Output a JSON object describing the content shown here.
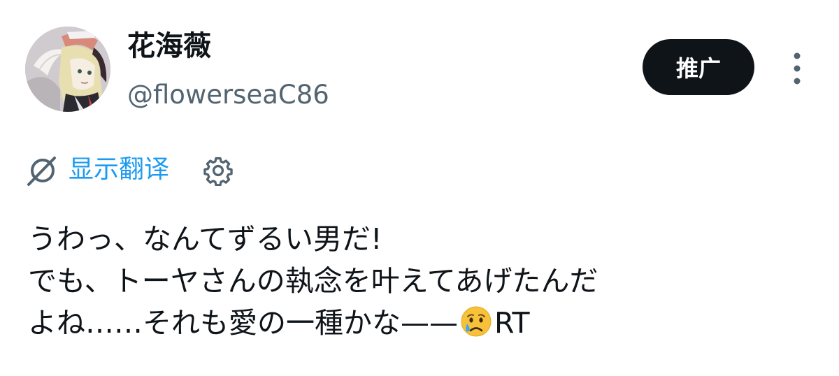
{
  "user": {
    "display_name": "花海薇",
    "handle": "@flowerseaC86"
  },
  "header": {
    "promote_label": "推广",
    "more_icon": "more-vertical-icon"
  },
  "translate": {
    "label": "显示翻译",
    "icon": "translate-icon",
    "settings_icon": "gear-icon"
  },
  "tweet": {
    "line1": "うわっ、なんてずるい男だ!",
    "line2": "でも、トーヤさんの執念を叶えてあげたんだ",
    "line3_before_emoji": "よね……それも愛の一種かな——",
    "emoji": "crying-face-emoji",
    "line3_after_emoji": "RT"
  },
  "colors": {
    "text": "#0f1419",
    "secondary_text": "#536471",
    "link": "#1d9bf0",
    "button_bg": "#0f1419",
    "button_text": "#ffffff"
  }
}
